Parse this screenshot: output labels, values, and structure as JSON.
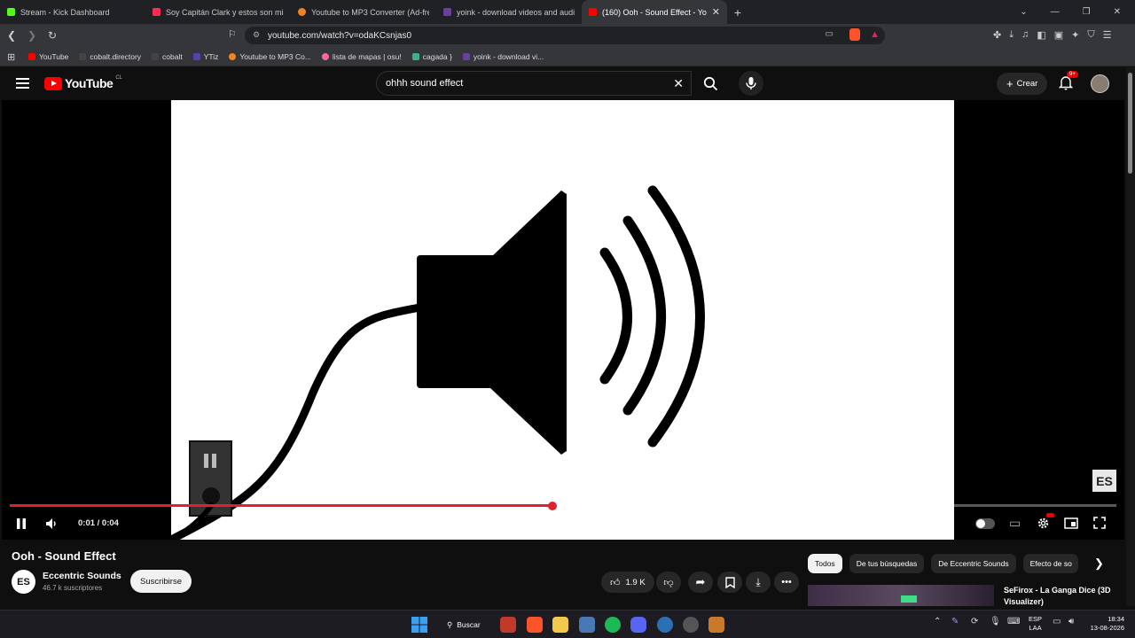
{
  "browser": {
    "tabs": [
      {
        "title": "Stream - Kick Dashboard",
        "color": "#53fc18"
      },
      {
        "title": "Soy Capitán Clark y estos son mis Ba",
        "color": "#fe2c55"
      },
      {
        "title": "Youtube to MP3 Converter (Ad-free)",
        "color": "#f58220"
      },
      {
        "title": "yoink - download videos and audio f",
        "color": "#6b3fa0"
      },
      {
        "title": "(160) Ooh - Sound Effect - Yo",
        "color": "#ff0000"
      }
    ],
    "new_tab": "+",
    "url": "youtube.com/watch?v=odaKCsnjas0",
    "bookmarks": [
      {
        "label": "YouTube",
        "color": "#ff0000"
      },
      {
        "label": "cobalt.directory",
        "color": "#444444"
      },
      {
        "label": "cobalt",
        "color": "#444444"
      },
      {
        "label": "YTiz",
        "color": "#5a3fb0"
      },
      {
        "label": "Youtube to MP3 Co...",
        "color": "#f58220"
      },
      {
        "label": "lista de mapas | osu!",
        "color": "#ff66aa"
      },
      {
        "label": "cagada }",
        "color": "#3fb08a"
      },
      {
        "label": "yoink - download vi...",
        "color": "#6b3fa0"
      }
    ]
  },
  "youtube": {
    "logo_text": "YouTube",
    "country": "CL",
    "search_query": "ohhh sound effect",
    "create_label": "Crear",
    "notif_badge": "9+",
    "player": {
      "current_time": "0:01",
      "duration": "0:04",
      "time_display": "0:01 / 0:04",
      "progress": 0.49,
      "watermark": "ES"
    },
    "video": {
      "title": "Ooh - Sound Effect",
      "channel_initials": "ES",
      "channel": "Eccentric Sounds",
      "subscribers": "46.7 k suscriptores",
      "subscribe_label": "Suscribirse",
      "likes": "1.9 K"
    },
    "chips": [
      "Todos",
      "De tus búsquedas",
      "De Eccentric Sounds",
      "Efecto de so"
    ],
    "recommended": {
      "title": "SeFirox - La Ganga Dice (3D Visualizer)"
    }
  },
  "taskbar": {
    "search_label": "Buscar",
    "lang": "ESP",
    "layout": "LAA",
    "time": "18:34",
    "date": "13-08-2026"
  }
}
